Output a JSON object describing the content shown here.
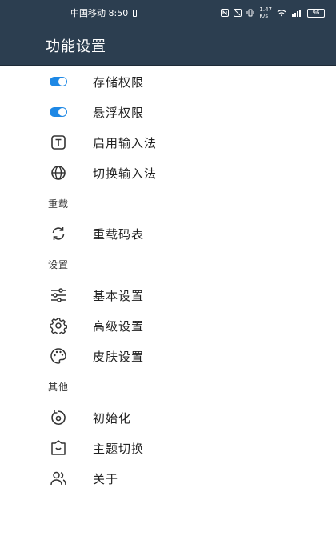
{
  "status_bar": {
    "carrier_time": "中国移动 8:50",
    "net_speed": "1.47\nK/s",
    "battery": "96"
  },
  "app_bar": {
    "title": "功能设置"
  },
  "items": {
    "storage_permission": {
      "label": "存储权限",
      "icon": "toggle-on",
      "enabled": true
    },
    "float_permission": {
      "label": "悬浮权限",
      "icon": "toggle-on",
      "enabled": true
    },
    "enable_ime": {
      "label": "启用输入法",
      "icon": "text-box-icon"
    },
    "switch_ime": {
      "label": "切换输入法",
      "icon": "globe-icon"
    }
  },
  "sections": {
    "reload": {
      "title": "重载",
      "items": {
        "reload_table": {
          "label": "重载码表",
          "icon": "refresh-icon"
        }
      }
    },
    "settings": {
      "title": "设置",
      "items": {
        "basic": {
          "label": "基本设置",
          "icon": "sliders-icon"
        },
        "advanced": {
          "label": "高级设置",
          "icon": "gear-icon"
        },
        "skin": {
          "label": "皮肤设置",
          "icon": "palette-icon"
        }
      }
    },
    "other": {
      "title": "其他",
      "items": {
        "init": {
          "label": "初始化",
          "icon": "restore-icon"
        },
        "theme": {
          "label": "主题切换",
          "icon": "theme-icon"
        },
        "about": {
          "label": "关于",
          "icon": "people-icon"
        }
      }
    }
  },
  "colors": {
    "app_bar_bg": "#2c3e50",
    "toggle_on": "#1e88e5"
  }
}
